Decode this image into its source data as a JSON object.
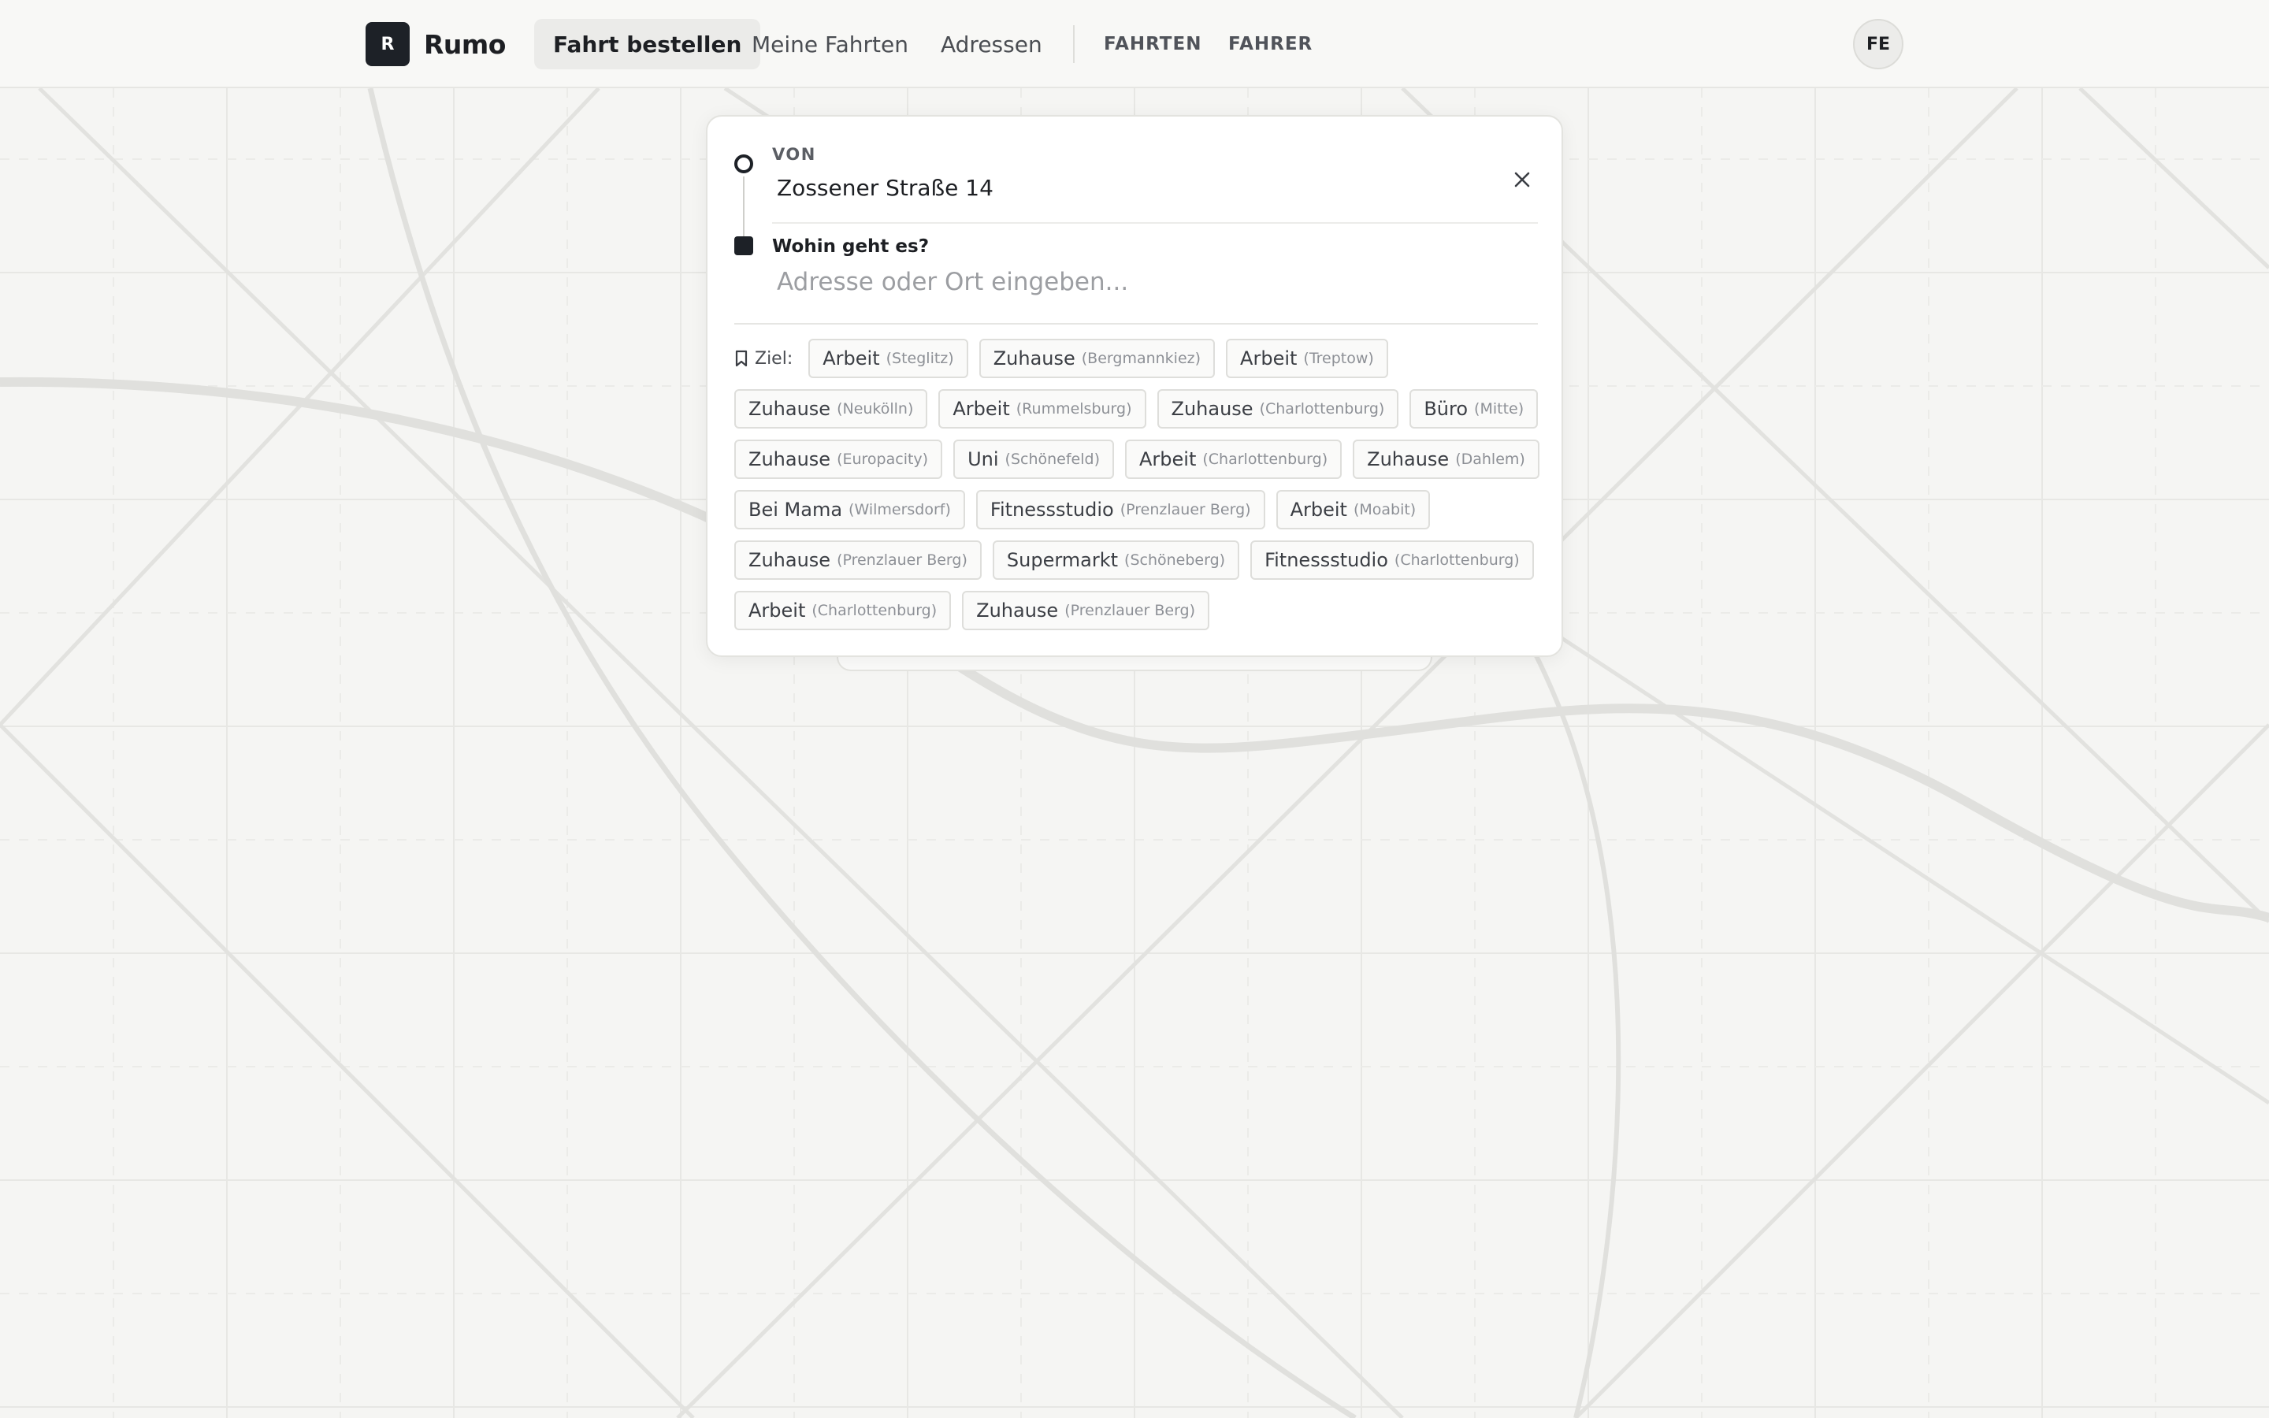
{
  "header": {
    "brand_mark": "R",
    "brand_name": "Rumo",
    "nav": [
      {
        "label": "Fahrt bestellen",
        "active": true
      },
      {
        "label": "Meine Fahrten",
        "active": false
      },
      {
        "label": "Adressen",
        "active": false
      }
    ],
    "nav_secondary": [
      {
        "label": "FAHRTEN"
      },
      {
        "label": "FAHRER"
      }
    ],
    "avatar": "FE"
  },
  "ride": {
    "from_label": "VON",
    "from_value": "Zossener Straße 14",
    "to_label": "Wohin geht es?",
    "to_placeholder": "Adresse oder Ort eingeben...",
    "to_value": "",
    "close_icon": "close-icon",
    "saved_label": "Ziel:",
    "saved_icon": "bookmark-icon"
  },
  "saved_rows": [
    [
      {
        "name": "Arbeit",
        "area": "(Steglitz)"
      },
      {
        "name": "Zuhause",
        "area": "(Bergmannkiez)"
      },
      {
        "name": "Arbeit",
        "area": "(Treptow)"
      }
    ],
    [
      {
        "name": "Zuhause",
        "area": "(Neukölln)"
      },
      {
        "name": "Arbeit",
        "area": "(Rummelsburg)"
      },
      {
        "name": "Zuhause",
        "area": "(Charlottenburg)"
      },
      {
        "name": "Büro",
        "area": "(Mitte)"
      }
    ],
    [
      {
        "name": "Zuhause",
        "area": "(Europacity)"
      },
      {
        "name": "Uni",
        "area": "(Schönefeld)"
      },
      {
        "name": "Arbeit",
        "area": "(Charlottenburg)"
      },
      {
        "name": "Zuhause",
        "area": "(Dahlem)"
      }
    ],
    [
      {
        "name": "Bei Mama",
        "area": "(Wilmersdorf)"
      },
      {
        "name": "Fitnessstudio",
        "area": "(Prenzlauer Berg)"
      },
      {
        "name": "Arbeit",
        "area": "(Moabit)"
      }
    ],
    [
      {
        "name": "Zuhause",
        "area": "(Prenzlauer Berg)"
      },
      {
        "name": "Supermarkt",
        "area": "(Schöneberg)"
      },
      {
        "name": "Fitnessstudio",
        "area": "(Charlottenburg)"
      }
    ],
    [
      {
        "name": "Arbeit",
        "area": "(Charlottenburg)"
      },
      {
        "name": "Zuhause",
        "area": "(Prenzlauer Berg)"
      }
    ]
  ],
  "colors": {
    "background": "#f5f5f3",
    "accent": "#1d2127",
    "map_road": "#e3e3e0"
  }
}
